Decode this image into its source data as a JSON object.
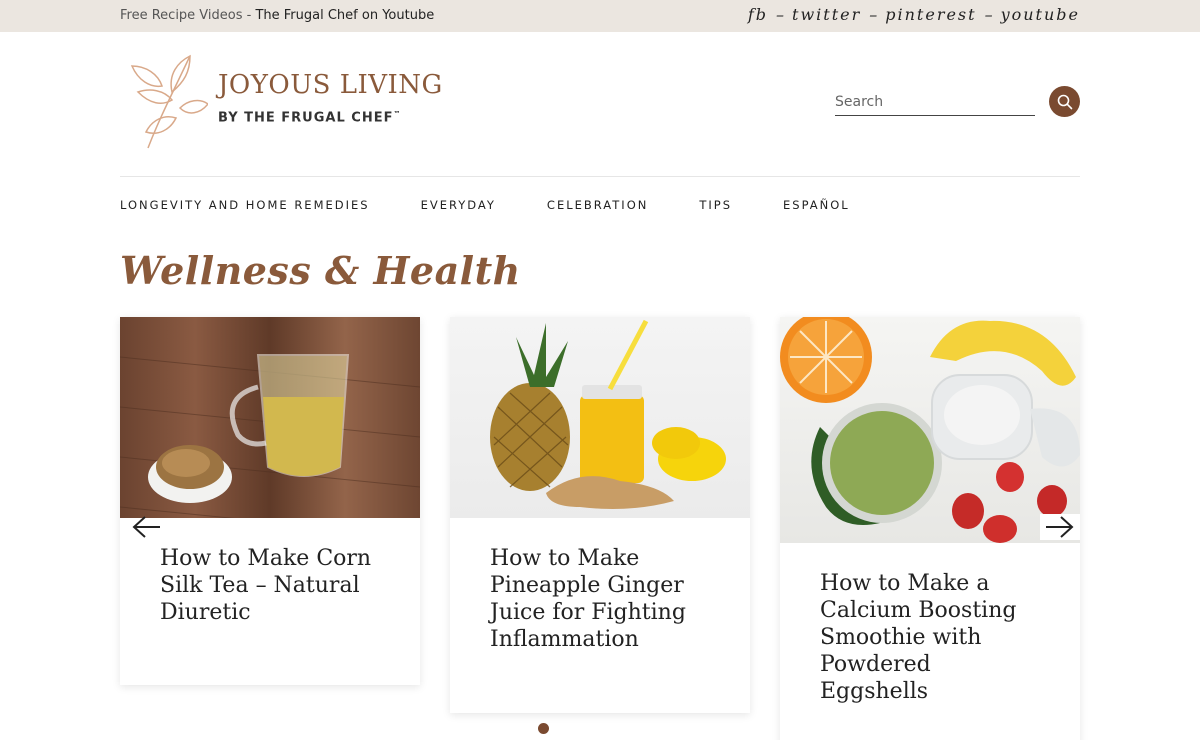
{
  "topbar": {
    "prefix": "Free Recipe Videos - ",
    "link": "The Frugal Chef on Youtube",
    "social": [
      "fb",
      "twitter",
      "pinterest",
      "youtube"
    ],
    "separator": "–"
  },
  "logo": {
    "title": "JOYOUS LIVING",
    "subtitle": "BY THE FRUGAL CHEF",
    "trademark": "™"
  },
  "search": {
    "placeholder": "Search"
  },
  "nav": [
    "LONGEVITY AND HOME REMEDIES",
    "EVERYDAY",
    "CELEBRATION",
    "TIPS",
    "ESPAÑOL"
  ],
  "section_title": "Wellness & Health",
  "cards": [
    {
      "title": "How to Make Corn Silk Tea – Natural Diuretic"
    },
    {
      "title": "How to Make Pineapple Ginger Juice for Fighting Inflammation"
    },
    {
      "title": "How to Make a Calcium Boosting Smoothie with Powdered Eggshells"
    }
  ],
  "colors": {
    "brand": "#8a5a3b",
    "accent": "#7a4a30",
    "topbar_bg": "#ebe6e0"
  }
}
